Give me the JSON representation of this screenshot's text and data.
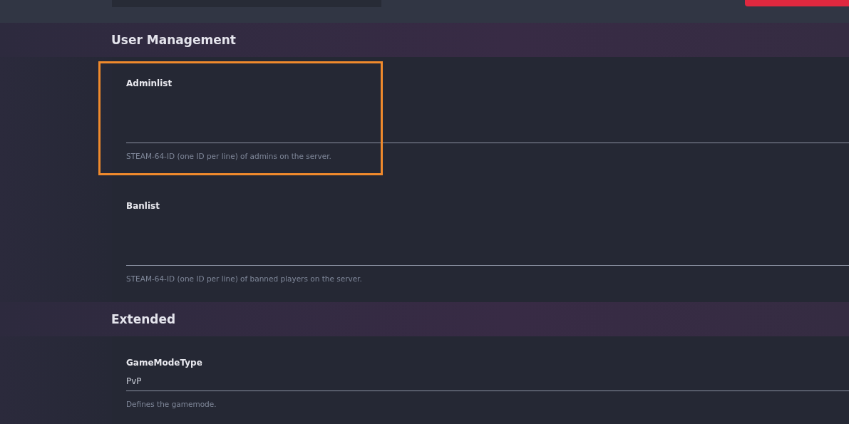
{
  "sections": [
    {
      "title": "User Management",
      "fields": [
        {
          "kind": "textarea",
          "label": "Adminlist",
          "hint": "STEAM-64-ID (one ID per line) of admins on the server.",
          "highlighted": true
        },
        {
          "kind": "textarea",
          "label": "Banlist",
          "hint": "STEAM-64-ID (one ID per line) of banned players on the server.",
          "highlighted": false
        }
      ]
    },
    {
      "title": "Extended",
      "fields": [
        {
          "kind": "input",
          "label": "GameModeType",
          "value": "PvP",
          "hint": "Defines the gamemode.",
          "highlighted": false
        }
      ]
    }
  ]
}
